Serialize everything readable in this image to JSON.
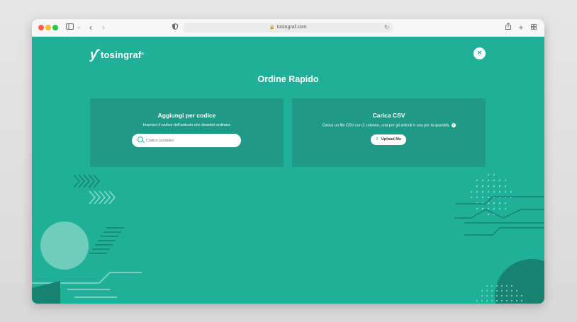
{
  "browser": {
    "url": "tosingraf.com"
  },
  "header": {
    "logo_text": "tosingraf"
  },
  "page": {
    "title": "Ordine Rapido"
  },
  "add_by_code": {
    "title": "Aggiungi per codice",
    "description": "Inserisci il codice dell'articolo che desideri ordinare",
    "search_placeholder": "Codice prodotto"
  },
  "csv_upload": {
    "title": "Carica CSV",
    "description": "Carica un file CSV con 2 colonne, una per gli articoli e una per la quantità.",
    "button_label": "Upload file"
  },
  "colors": {
    "background": "#20b09a",
    "card": "#1f9a86",
    "accent_dark": "#16826f"
  }
}
